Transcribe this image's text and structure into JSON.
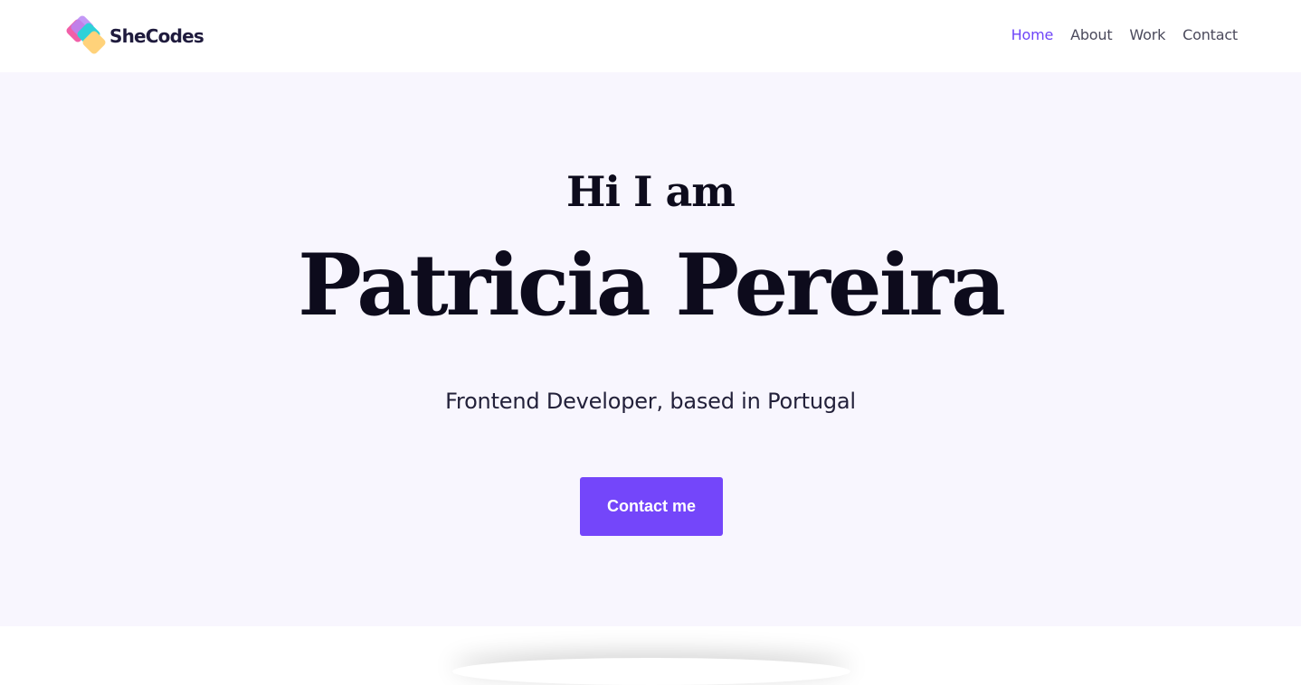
{
  "header": {
    "logo_text": "SheCodes",
    "nav": [
      {
        "label": "Home",
        "active": true
      },
      {
        "label": "About",
        "active": false
      },
      {
        "label": "Work",
        "active": false
      },
      {
        "label": "Contact",
        "active": false
      }
    ]
  },
  "hero": {
    "intro": "Hi I am",
    "name": "Patricia Pereira",
    "tagline": "Frontend Developer, based in Portugal",
    "cta_label": "Contact me"
  },
  "colors": {
    "accent": "#7446fa",
    "nav_active": "#6e45f8",
    "hero_bg": "#f8f6fe",
    "text_dark": "#0d0b1c"
  }
}
